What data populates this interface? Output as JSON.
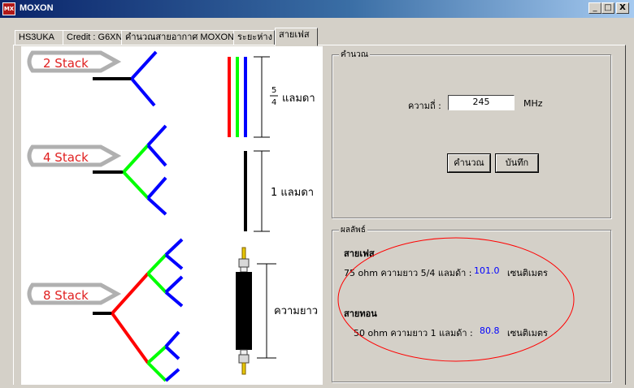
{
  "window": {
    "title": "MOXON",
    "icon": "moxon-app-icon",
    "icon_text": "MX",
    "minimize_label": "_",
    "maximize_label": "□",
    "close_label": "X"
  },
  "tabs": [
    {
      "label": "HS3UKA"
    },
    {
      "label": "Credit : G6XN"
    },
    {
      "label": "คำนวณสายอากาศ MOXON"
    },
    {
      "label": "ระยะห่าง"
    },
    {
      "label": "สายเฟส"
    }
  ],
  "active_tab": 4,
  "diagram": {
    "stack2_label": "2 Stack",
    "stack4_label": "4 Stack",
    "stack8_label": "8 Stack",
    "lambda_frac_num": "5",
    "lambda_frac_den": "4",
    "lambda_54_text": "แลมดา",
    "lambda_1_label": "1 แลมดา",
    "length_label": "ความยาว",
    "colors": {
      "red": "#ff0000",
      "green": "#00ff00",
      "blue": "#0000ff",
      "black": "#000000",
      "bubble": "#b8b8b8",
      "stack_text": "#e02020"
    }
  },
  "calc": {
    "legend": "คำนวณ",
    "freq_label": "ความถี่ :",
    "freq_value": "245",
    "freq_unit": "MHz",
    "calc_button": "คำนวณ",
    "save_button": "บันทึก"
  },
  "result": {
    "legend": "ผลลัพธ์",
    "phase_title": "สายเฟส",
    "phase_desc": "75 ohm ความยาว 5/4 แลมด้า :",
    "phase_value": "101.0",
    "phase_unit": "เซนติเมตร",
    "match_title": "สายทอน",
    "match_desc": "50 ohm ความยาว 1 แลมด้า :",
    "match_value": "80.8",
    "match_unit": "เซนติเมตร",
    "highlight_color": "#ff0000",
    "value_color": "#0000ff"
  }
}
